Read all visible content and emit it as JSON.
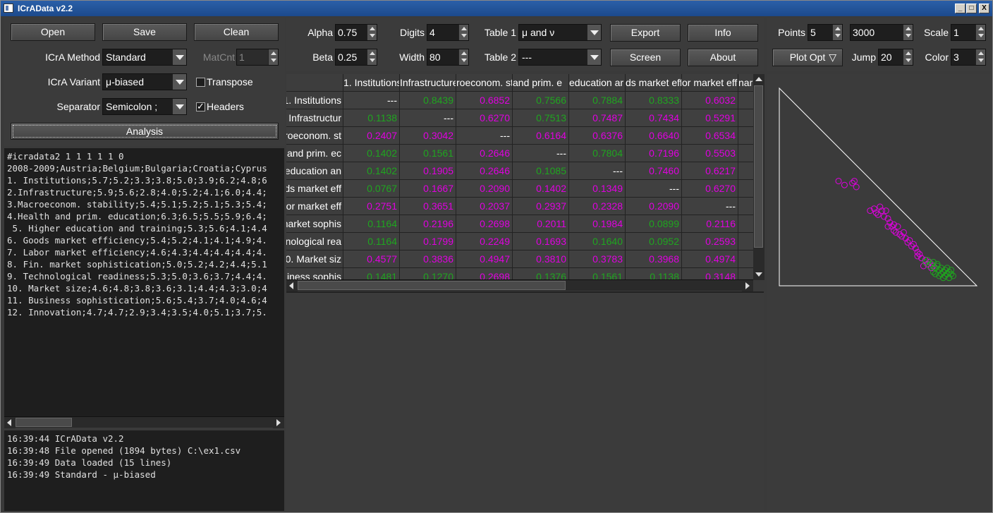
{
  "window": {
    "title": "ICrAData v2.2",
    "min_label": "_",
    "max_label": "□",
    "close_label": "X"
  },
  "left": {
    "open_label": "Open",
    "save_label": "Save",
    "clean_label": "Clean",
    "method_label": "ICrA Method",
    "method_value": "Standard",
    "matcnt_label": "MatCnt",
    "matcnt_value": "1",
    "variant_label": "ICrA Variant",
    "variant_value": "μ-biased",
    "transpose_label": "Transpose",
    "separator_label": "Separator",
    "separator_value": "Semicolon ;",
    "headers_label": "Headers",
    "analysis_label": "Analysis",
    "editor_lines": [
      "#icradata2 1 1 1 1 1 0",
      "2008-2009;Austria;Belgium;Bulgaria;Croatia;Cyprus",
      "1. Institutions;5.7;5.2;3.3;3.8;5.0;3.9;6.2;4.8;6",
      "2.Infrastructure;5.9;5.6;2.8;4.0;5.2;4.1;6.0;4.4;",
      "3.Macroeconom. stability;5.4;5.1;5.2;5.1;5.3;5.4;",
      "4.Health and prim. education;6.3;6.5;5.5;5.9;6.4;",
      " 5. Higher education and training;5.3;5.6;4.1;4.4",
      "6. Goods market efficiency;5.4;5.2;4.1;4.1;4.9;4.",
      "7. Labor market efficiency;4.6;4.3;4.4;4.4;4.4;4.",
      "8. Fin. market sophistication;5.0;5.2;4.2;4.4;5.1",
      "9. Technological readiness;5.3;5.0;3.6;3.7;4.4;4.",
      "10. Market size;4.6;4.8;3.8;3.6;3.1;4.4;4.3;3.0;4",
      "11. Business sophistication;5.6;5.4;3.7;4.0;4.6;4",
      "12. Innovation;4.7;4.7;2.9;3.4;3.5;4.0;5.1;3.7;5."
    ],
    "log_lines": [
      "16:39:44 ICrAData v2.2",
      "16:39:48 File opened (1894 bytes) C:\\ex1.csv",
      "16:39:49 Data loaded (15 lines)",
      "16:39:49 Standard - μ-biased"
    ]
  },
  "middle": {
    "alpha_label": "Alpha",
    "alpha_value": "0.75",
    "beta_label": "Beta",
    "beta_value": "0.25",
    "digits_label": "Digits",
    "digits_value": "4",
    "width_label": "Width",
    "width_value": "80",
    "table1_label": "Table 1",
    "table1_value": "μ and ν",
    "table2_label": "Table 2",
    "table2_value": "---",
    "export_label": "Export",
    "screen_label": "Screen",
    "info_label": "Info",
    "about_label": "About"
  },
  "right": {
    "points_label": "Points",
    "points_value": "5",
    "max_value": "3000",
    "scale_label": "Scale",
    "scale_value": "1",
    "plotopt_label": "Plot Opt",
    "jump_label": "Jump",
    "jump_value": "20",
    "color_label": "Color",
    "color_value": "3"
  },
  "table": {
    "columns": [
      "1. Institutions",
      "Infrastructure",
      "roeconom. st",
      "and prim. e",
      "education ar",
      "ds market effi",
      "or market eff",
      "nar"
    ],
    "rows": [
      {
        "head": "1. Institutions",
        "cells": [
          [
            "---",
            "d"
          ],
          [
            "0.8439",
            "g"
          ],
          [
            "0.6852",
            "m"
          ],
          [
            "0.7566",
            "g"
          ],
          [
            "0.7884",
            "g"
          ],
          [
            "0.8333",
            "g"
          ],
          [
            "0.6032",
            "m"
          ]
        ]
      },
      {
        "head": "Infrastructur",
        "cells": [
          [
            "0.1138",
            "g"
          ],
          [
            "---",
            "d"
          ],
          [
            "0.6270",
            "m"
          ],
          [
            "0.7513",
            "g"
          ],
          [
            "0.7487",
            "m"
          ],
          [
            "0.7434",
            "m"
          ],
          [
            "0.5291",
            "m"
          ]
        ]
      },
      {
        "head": "roeconom. st",
        "cells": [
          [
            "0.2407",
            "m"
          ],
          [
            "0.3042",
            "m"
          ],
          [
            "---",
            "d"
          ],
          [
            "0.6164",
            "m"
          ],
          [
            "0.6376",
            "m"
          ],
          [
            "0.6640",
            "m"
          ],
          [
            "0.6534",
            "m"
          ]
        ]
      },
      {
        "head": "and prim. ec",
        "cells": [
          [
            "0.1402",
            "g"
          ],
          [
            "0.1561",
            "g"
          ],
          [
            "0.2646",
            "m"
          ],
          [
            "---",
            "d"
          ],
          [
            "0.7804",
            "g"
          ],
          [
            "0.7196",
            "m"
          ],
          [
            "0.5503",
            "m"
          ]
        ]
      },
      {
        "head": "education an",
        "cells": [
          [
            "0.1402",
            "g"
          ],
          [
            "0.1905",
            "m"
          ],
          [
            "0.2646",
            "m"
          ],
          [
            "0.1085",
            "g"
          ],
          [
            "---",
            "d"
          ],
          [
            "0.7460",
            "m"
          ],
          [
            "0.6217",
            "m"
          ]
        ]
      },
      {
        "head": "ds market eff",
        "cells": [
          [
            "0.0767",
            "g"
          ],
          [
            "0.1667",
            "m"
          ],
          [
            "0.2090",
            "m"
          ],
          [
            "0.1402",
            "m"
          ],
          [
            "0.1349",
            "m"
          ],
          [
            "---",
            "d"
          ],
          [
            "0.6270",
            "m"
          ]
        ]
      },
      {
        "head": "or market eff",
        "cells": [
          [
            "0.2751",
            "m"
          ],
          [
            "0.3651",
            "m"
          ],
          [
            "0.2037",
            "m"
          ],
          [
            "0.2937",
            "m"
          ],
          [
            "0.2328",
            "m"
          ],
          [
            "0.2090",
            "m"
          ],
          [
            "---",
            "d"
          ]
        ]
      },
      {
        "head": "market sophis",
        "cells": [
          [
            "0.1164",
            "g"
          ],
          [
            "0.2196",
            "m"
          ],
          [
            "0.2698",
            "m"
          ],
          [
            "0.2011",
            "m"
          ],
          [
            "0.1984",
            "m"
          ],
          [
            "0.0899",
            "g"
          ],
          [
            "0.2116",
            "m"
          ]
        ]
      },
      {
        "head": "nological rea",
        "cells": [
          [
            "0.1164",
            "g"
          ],
          [
            "0.1799",
            "m"
          ],
          [
            "0.2249",
            "m"
          ],
          [
            "0.1693",
            "m"
          ],
          [
            "0.1640",
            "g"
          ],
          [
            "0.0952",
            "g"
          ],
          [
            "0.2593",
            "m"
          ]
        ]
      },
      {
        "head": "0. Market siz",
        "cells": [
          [
            "0.4577",
            "m"
          ],
          [
            "0.3836",
            "m"
          ],
          [
            "0.4947",
            "m"
          ],
          [
            "0.3810",
            "m"
          ],
          [
            "0.3783",
            "m"
          ],
          [
            "0.3968",
            "m"
          ],
          [
            "0.4974",
            "m"
          ]
        ]
      },
      {
        "head": "iness sophis",
        "cells": [
          [
            "0.1481",
            "g"
          ],
          [
            "0.1270",
            "g"
          ],
          [
            "0.2698",
            "m"
          ],
          [
            "0.1376",
            "g"
          ],
          [
            "0.1561",
            "g"
          ],
          [
            "0.1138",
            "g"
          ],
          [
            "0.3148",
            "m"
          ]
        ]
      }
    ]
  },
  "plot": {
    "magenta_points": [
      [
        0.3,
        0.53
      ],
      [
        0.33,
        0.51
      ],
      [
        0.37,
        0.52
      ],
      [
        0.39,
        0.5
      ],
      [
        0.38,
        0.53
      ],
      [
        0.46,
        0.38
      ],
      [
        0.48,
        0.39
      ],
      [
        0.49,
        0.37
      ],
      [
        0.5,
        0.36
      ],
      [
        0.51,
        0.4
      ],
      [
        0.52,
        0.38
      ],
      [
        0.53,
        0.35
      ],
      [
        0.54,
        0.38
      ],
      [
        0.55,
        0.34
      ],
      [
        0.56,
        0.32
      ],
      [
        0.55,
        0.3
      ],
      [
        0.57,
        0.3
      ],
      [
        0.58,
        0.31
      ],
      [
        0.58,
        0.28
      ],
      [
        0.59,
        0.27
      ],
      [
        0.6,
        0.3
      ],
      [
        0.61,
        0.26
      ],
      [
        0.62,
        0.25
      ],
      [
        0.63,
        0.27
      ],
      [
        0.64,
        0.24
      ],
      [
        0.65,
        0.22
      ],
      [
        0.66,
        0.23
      ],
      [
        0.67,
        0.2
      ],
      [
        0.68,
        0.21
      ],
      [
        0.69,
        0.19
      ],
      [
        0.7,
        0.17
      ],
      [
        0.71,
        0.16
      ],
      [
        0.72,
        0.14
      ],
      [
        0.7,
        0.15
      ],
      [
        0.74,
        0.13
      ],
      [
        0.75,
        0.11
      ],
      [
        0.76,
        0.12
      ],
      [
        0.73,
        0.1
      ],
      [
        0.78,
        0.1
      ],
      [
        0.77,
        0.09
      ]
    ],
    "green_points": [
      [
        0.74,
        0.12
      ],
      [
        0.75,
        0.13
      ],
      [
        0.76,
        0.1
      ],
      [
        0.77,
        0.11
      ],
      [
        0.78,
        0.12
      ],
      [
        0.79,
        0.09
      ],
      [
        0.8,
        0.1
      ],
      [
        0.81,
        0.08
      ],
      [
        0.82,
        0.09
      ],
      [
        0.83,
        0.07
      ],
      [
        0.84,
        0.08
      ],
      [
        0.85,
        0.06
      ],
      [
        0.86,
        0.07
      ],
      [
        0.87,
        0.06
      ],
      [
        0.88,
        0.05
      ],
      [
        0.8,
        0.11
      ],
      [
        0.82,
        0.06
      ],
      [
        0.84,
        0.05
      ],
      [
        0.86,
        0.04
      ],
      [
        0.78,
        0.07
      ],
      [
        0.79,
        0.06
      ],
      [
        0.81,
        0.05
      ],
      [
        0.83,
        0.04
      ],
      [
        0.85,
        0.09
      ],
      [
        0.87,
        0.08
      ]
    ],
    "colors": {
      "magenta": "#e000e0",
      "green": "#1fa51f"
    }
  }
}
